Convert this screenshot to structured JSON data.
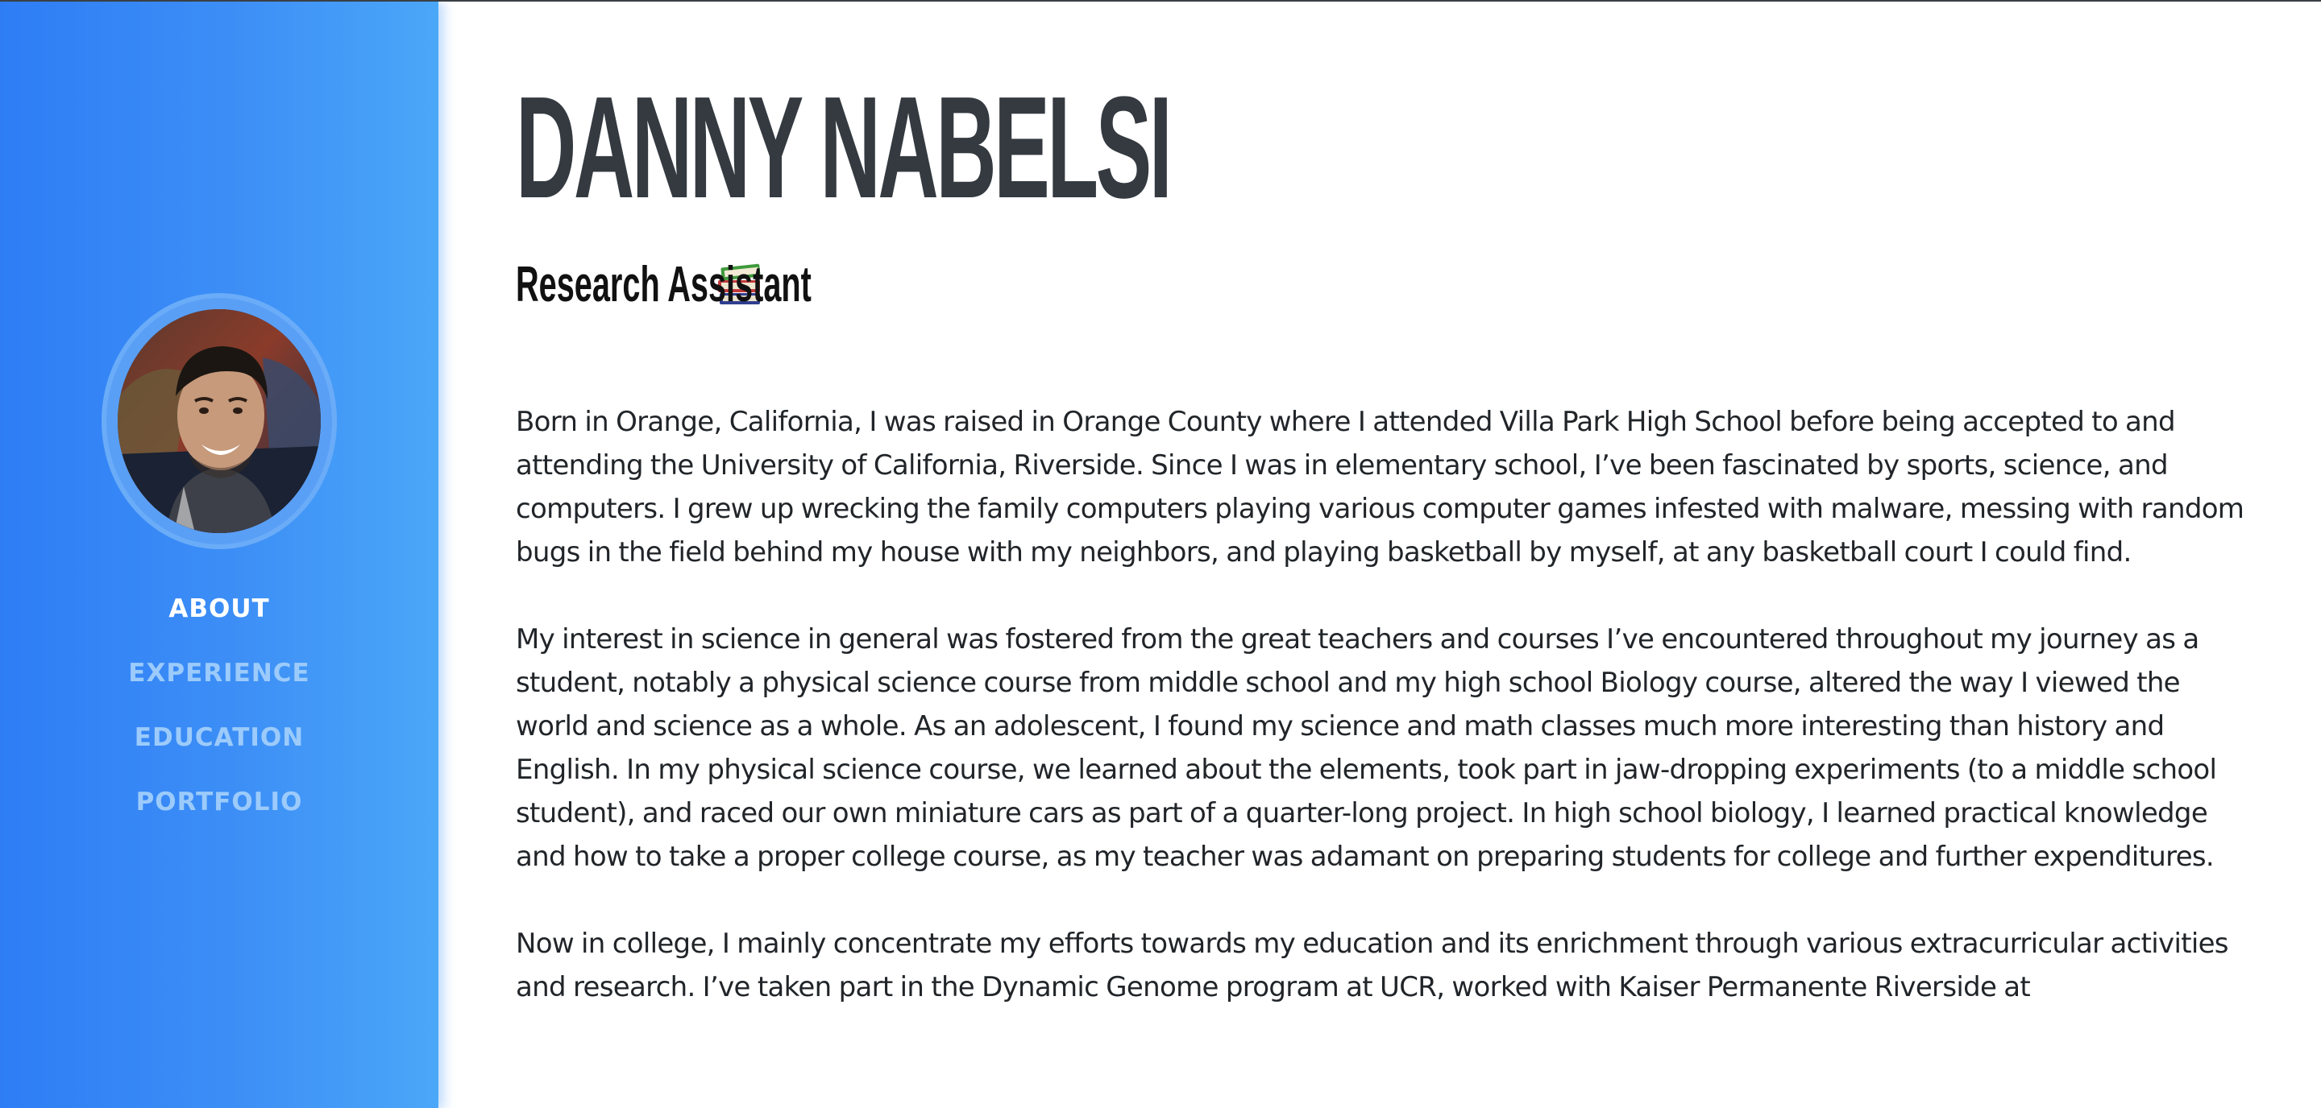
{
  "profile": {
    "name": "DANNY NABELSI",
    "title": "Research Assistant",
    "title_icon": "books-icon"
  },
  "nav": {
    "items": [
      {
        "label": "ABOUT",
        "active": true
      },
      {
        "label": "EXPERIENCE",
        "active": false
      },
      {
        "label": "EDUCATION",
        "active": false
      },
      {
        "label": "PORTFOLIO",
        "active": false
      }
    ]
  },
  "about": {
    "paragraphs": [
      "Born in Orange, California, I was raised in Orange County where I attended Villa Park High School before being accepted to and attending the University of California, Riverside. Since I was in elementary school, I’ve been fascinated by sports, science, and computers. I grew up wrecking the family computers playing various computer games infested with malware, messing with random bugs in the field behind my house with my neighbors, and playing basketball by myself, at any basketball court I could find.",
      "My interest in science in general was fostered from the great teachers and courses I’ve encountered throughout my journey as a student, notably a physical science course from middle school and my high school Biology course, altered the way I viewed the world and science as a whole. As an adolescent, I found my science and math classes much more interesting than history and English. In my physical science course, we learned about the elements, took part in jaw-dropping experiments (to a middle school student), and raced our own miniature cars as part of a quarter-long project. In high school biology, I learned practical knowledge and how to take a proper college course, as my teacher was adamant on preparing students for college and further expenditures.",
      "Now in college, I mainly concentrate my efforts towards my education and its enrichment through various extracurricular activities and research. I’ve taken part in the Dynamic Genome program at UCR, worked with Kaiser Permanente Riverside at"
    ]
  },
  "colors": {
    "sidebar_start": "#2e7df5",
    "sidebar_end": "#4ba7f8",
    "nav_active": "#ffffff",
    "nav_inactive": "#9ccbfb",
    "heading": "#343a40",
    "body_text": "#212529"
  }
}
